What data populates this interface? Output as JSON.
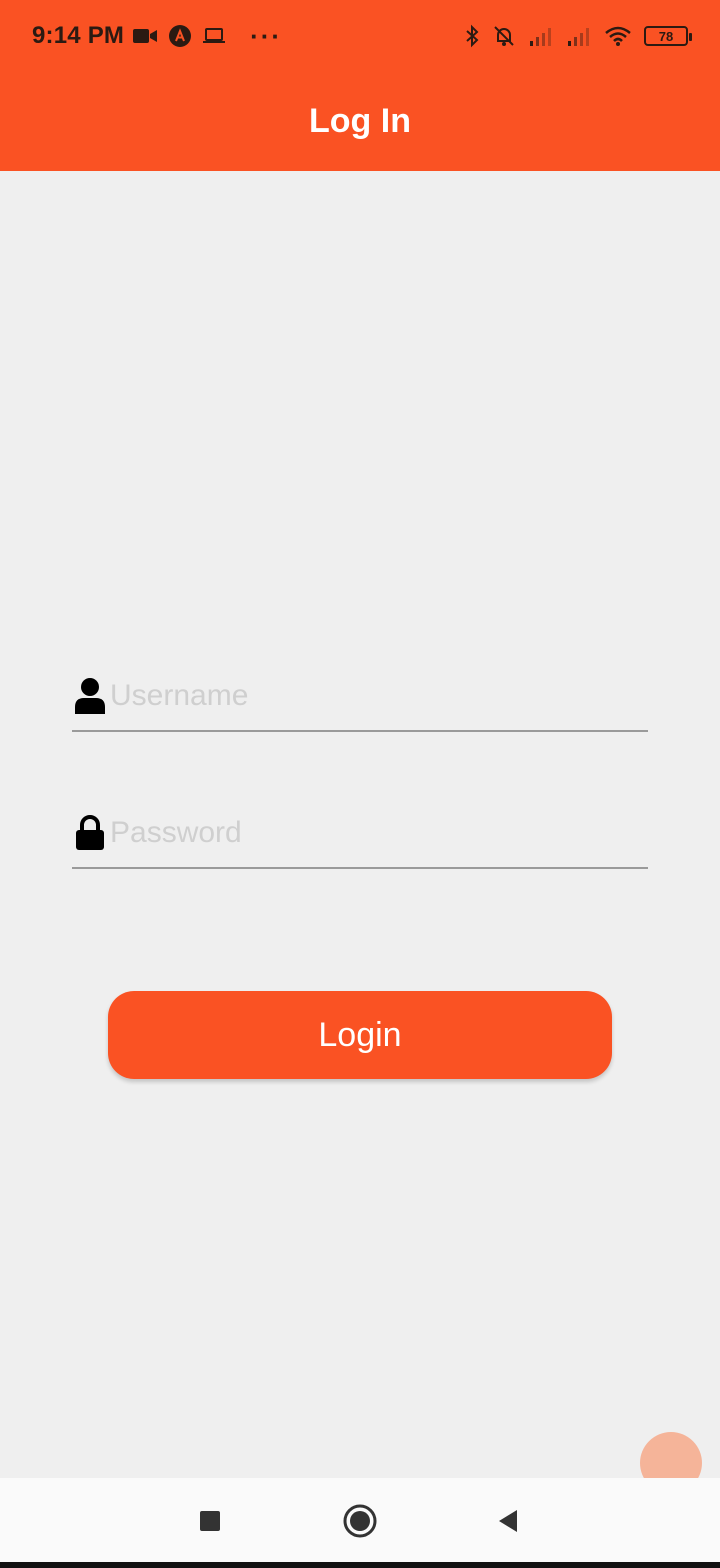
{
  "status_bar": {
    "time": "9:14 PM",
    "left_icons": [
      "video-camera-icon",
      "app-notification-icon",
      "laptop-icon",
      "more-dots-icon"
    ],
    "more": "···",
    "right_icons": [
      "bluetooth-icon",
      "bell-muted-icon",
      "signal-icon",
      "signal-icon",
      "wifi-icon",
      "battery-icon"
    ],
    "battery_level": "78"
  },
  "app_bar": {
    "title": "Log In"
  },
  "form": {
    "username": {
      "placeholder": "Username",
      "value": "",
      "icon": "user-icon"
    },
    "password": {
      "placeholder": "Password",
      "value": "",
      "icon": "lock-icon"
    },
    "login_label": "Login"
  },
  "colors": {
    "accent": "#fa5223",
    "background": "#efefef",
    "placeholder": "#cfcfcf"
  },
  "nav_bar": {
    "buttons": [
      "recents-icon",
      "home-icon",
      "back-icon"
    ]
  }
}
